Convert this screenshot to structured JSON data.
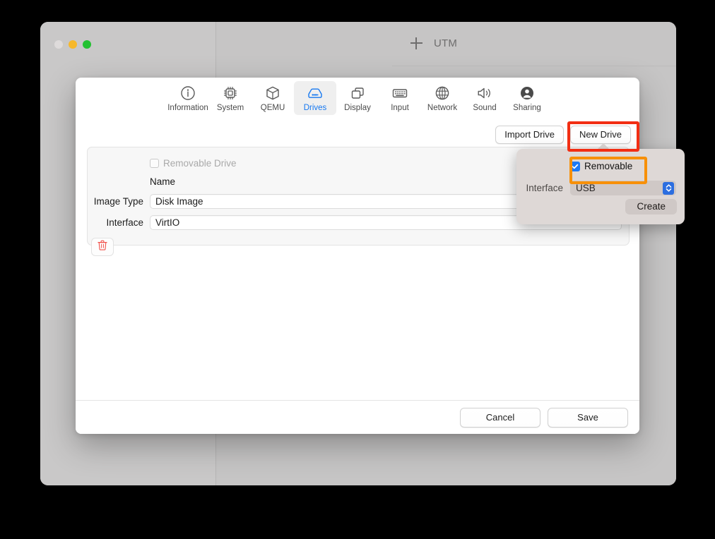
{
  "background_window": {
    "title": "UTM",
    "new_icon": "plus-icon",
    "traffic_lights": [
      "close-light",
      "minimize-light",
      "maximize-light"
    ]
  },
  "settings_sheet": {
    "toolbar": {
      "items": [
        {
          "label": "Information",
          "icon": "info-circle-icon",
          "active": false
        },
        {
          "label": "System",
          "icon": "cpu-chip-icon",
          "active": false
        },
        {
          "label": "QEMU",
          "icon": "cube-box-icon",
          "active": false
        },
        {
          "label": "Drives",
          "icon": "internal-drive-icon",
          "active": true
        },
        {
          "label": "Display",
          "icon": "windows-stack-icon",
          "active": false
        },
        {
          "label": "Input",
          "icon": "keyboard-icon",
          "active": false
        },
        {
          "label": "Network",
          "icon": "globe-icon",
          "active": false
        },
        {
          "label": "Sound",
          "icon": "speaker-wave-icon",
          "active": false
        },
        {
          "label": "Sharing",
          "icon": "person-circle-icon",
          "active": false
        }
      ],
      "active_color": "#1678f0"
    },
    "actions": {
      "import_drive": "Import Drive",
      "new_drive": "New Drive"
    },
    "drive": {
      "removable_checkbox_label": "Removable Drive",
      "removable_checked": false,
      "name_label": "Name",
      "image_type_label": "Image Type",
      "image_type_value": "Disk Image",
      "interface_label": "Interface",
      "interface_value": "VirtIO",
      "delete_icon": "trash-icon"
    },
    "footer": {
      "cancel": "Cancel",
      "save": "Save"
    }
  },
  "popover": {
    "removable_label": "Removable",
    "removable_checked": true,
    "interface_label": "Interface",
    "interface_value": "USB",
    "create_label": "Create",
    "stepper_icon": "chevron-up-down-icon",
    "background_color": "#ded8d6",
    "accent_color": "#1d7af5"
  },
  "highlights": {
    "new_drive_box_color": "#f22e13",
    "removable_box_color": "#f79009"
  }
}
